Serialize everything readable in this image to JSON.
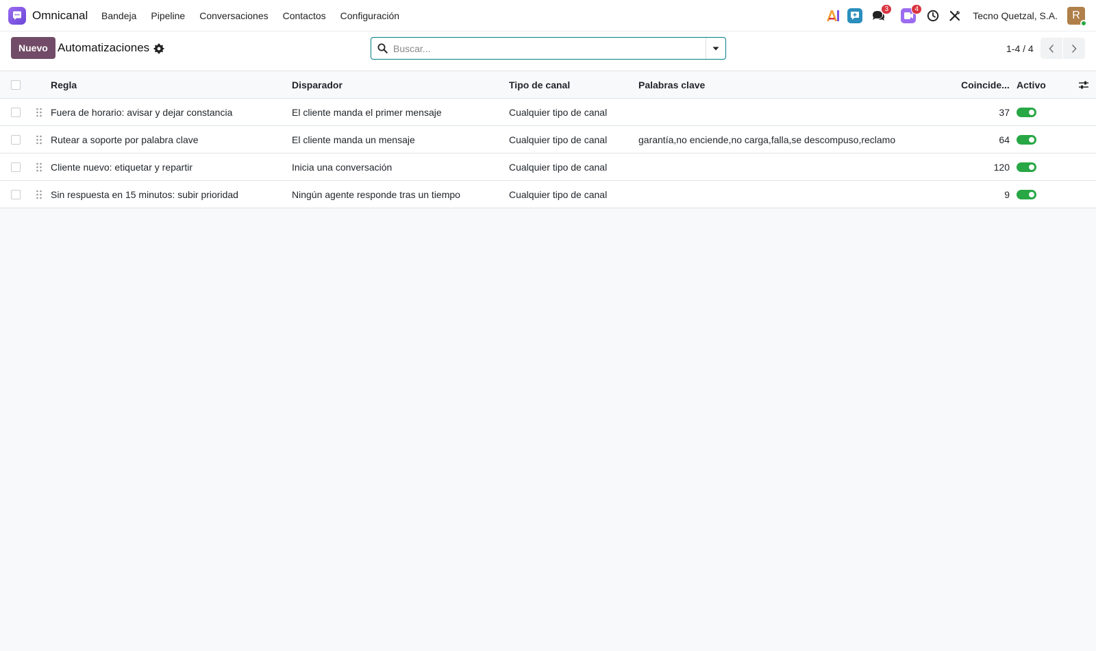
{
  "navbar": {
    "app_name": "Omnicanal",
    "menu": [
      {
        "label": "Bandeja"
      },
      {
        "label": "Pipeline"
      },
      {
        "label": "Conversaciones"
      },
      {
        "label": "Contactos"
      },
      {
        "label": "Configuración"
      }
    ],
    "tray": {
      "messages_count": "3",
      "activities_count": "4",
      "company": "Tecno Quetzal, S.A.",
      "avatar_initial": "R"
    }
  },
  "control_panel": {
    "new_button": "Nuevo",
    "title": "Automatizaciones",
    "search_placeholder": "Buscar...",
    "pager_value": "1-4 / 4"
  },
  "table": {
    "headers": {
      "rule": "Regla",
      "trigger": "Disparador",
      "channel": "Tipo de canal",
      "keywords": "Palabras clave",
      "matches": "Coincide...",
      "active": "Activo"
    },
    "rows": [
      {
        "rule": "Fuera de horario: avisar y dejar constancia",
        "trigger": "El cliente manda el primer mensaje",
        "channel": "Cualquier tipo de canal",
        "keywords": "",
        "matches": "37",
        "active": true
      },
      {
        "rule": "Rutear a soporte por palabra clave",
        "trigger": "El cliente manda un mensaje",
        "channel": "Cualquier tipo de canal",
        "keywords": "garantía,no enciende,no carga,falla,se descompuso,reclamo",
        "matches": "64",
        "active": true
      },
      {
        "rule": "Cliente nuevo: etiquetar y repartir",
        "trigger": "Inicia una conversación",
        "channel": "Cualquier tipo de canal",
        "keywords": "",
        "matches": "120",
        "active": true
      },
      {
        "rule": "Sin respuesta en 15 minutos: subir prioridad",
        "trigger": "Ningún agente responde tras un tiempo",
        "channel": "Cualquier tipo de canal",
        "keywords": "",
        "matches": "9",
        "active": true
      }
    ]
  },
  "colors": {
    "primary": "#714b67",
    "accent": "#017e84",
    "toggle_on": "#28a745",
    "badge": "#d9343f"
  }
}
